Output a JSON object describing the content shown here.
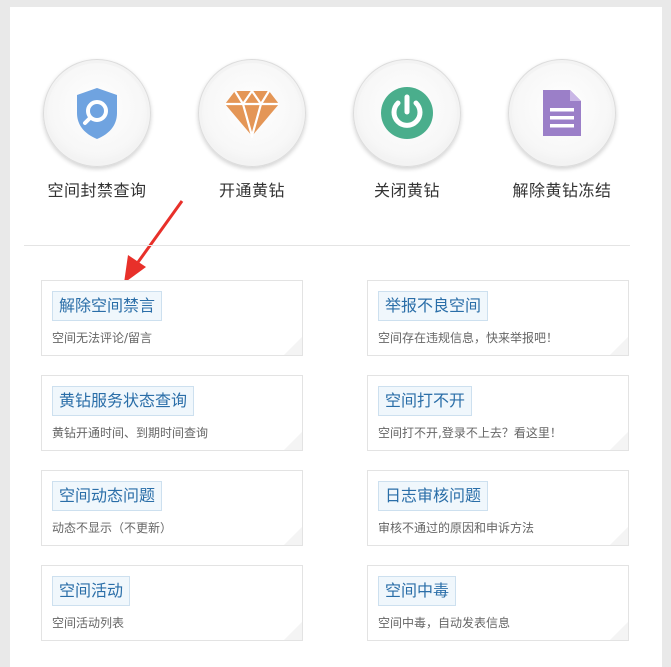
{
  "quick_actions": [
    {
      "label": "空间封禁查询",
      "icon": "shield-search-icon",
      "color": "#6fa3e0"
    },
    {
      "label": "开通黄钻",
      "icon": "diamond-icon",
      "color": "#e49656"
    },
    {
      "label": "关闭黄钻",
      "icon": "power-icon",
      "color": "#4aae8c"
    },
    {
      "label": "解除黄钻冻结",
      "icon": "document-icon",
      "color": "#9b7fc8"
    }
  ],
  "cards": [
    {
      "title": "解除空间禁言",
      "desc": "空间无法评论/留言"
    },
    {
      "title": "举报不良空间",
      "desc": "空间存在违规信息，快来举报吧！"
    },
    {
      "title": "黄钻服务状态查询",
      "desc": "黄钻开通时间、到期时间查询"
    },
    {
      "title": "空间打不开",
      "desc": "空间打不开,登录不上去？看这里！"
    },
    {
      "title": "空间动态问题",
      "desc": "动态不显示（不更新）"
    },
    {
      "title": "日志审核问题",
      "desc": "审核不通过的原因和申诉方法"
    },
    {
      "title": "空间活动",
      "desc": "空间活动列表"
    },
    {
      "title": "空间中毒",
      "desc": "空间中毒，自动发表信息"
    }
  ],
  "colors": {
    "accent": "#2a6ea8",
    "arrow": "#e8302a"
  }
}
